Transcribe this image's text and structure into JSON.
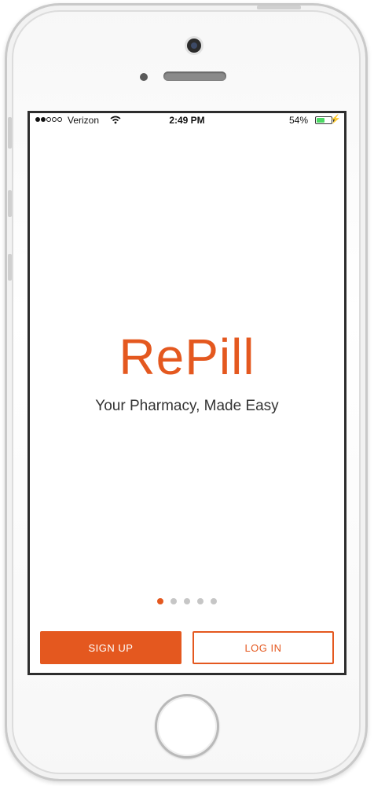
{
  "status_bar": {
    "carrier": "Verizon",
    "time": "2:49 PM",
    "battery_percent": "54%",
    "battery_level": 0.54,
    "signal_bars_filled": 2,
    "signal_bars_total": 5
  },
  "brand": {
    "name": "RePill",
    "tagline": "Your Pharmacy, Made Easy",
    "accent_color": "#e4581f"
  },
  "pager": {
    "total": 5,
    "active_index": 0
  },
  "actions": {
    "signup_label": "SIGN UP",
    "login_label": "LOG IN"
  },
  "icons": {
    "wifi": "wifi-icon",
    "battery": "battery-icon",
    "charging": "charging-bolt-icon",
    "camera": "front-camera",
    "home": "home-button"
  }
}
